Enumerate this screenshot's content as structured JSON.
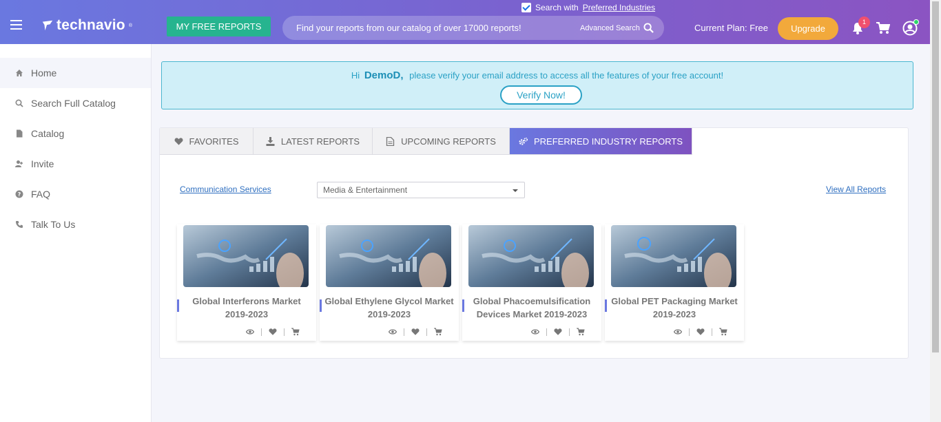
{
  "header": {
    "logo_text": "technavio",
    "logo_mark": "®",
    "free_reports_label": "MY FREE REPORTS",
    "search_placeholder": "Find your reports from our catalog of over 17000 reports!",
    "advanced_search": "Advanced Search",
    "pref_prefix": "Search with",
    "pref_link": "Preferred Industries",
    "pref_checked": true,
    "plan_text": "Current Plan: Free",
    "upgrade_label": "Upgrade",
    "notification_count": "1"
  },
  "sidebar": {
    "items": [
      {
        "label": "Home",
        "icon": "home-icon"
      },
      {
        "label": "Search Full Catalog",
        "icon": "search-icon"
      },
      {
        "label": "Catalog",
        "icon": "file-icon"
      },
      {
        "label": "Invite",
        "icon": "user-plus-icon"
      },
      {
        "label": "FAQ",
        "icon": "question-circle-icon"
      },
      {
        "label": "Talk To Us",
        "icon": "phone-icon"
      }
    ]
  },
  "alert": {
    "greeting": "Hi",
    "username": "DemoD,",
    "message": "please verify your email address to access all the features of your free account!",
    "verify_label": "Verify Now!"
  },
  "tabs": [
    {
      "label": "FAVORITES",
      "icon": "heart-icon"
    },
    {
      "label": "LATEST REPORTS",
      "icon": "download-icon"
    },
    {
      "label": "UPCOMING REPORTS",
      "icon": "document-icon"
    },
    {
      "label": "PREFERRED INDUSTRY REPORTS",
      "icon": "cogs-icon"
    }
  ],
  "filters": {
    "industry_link": "Communication Services",
    "subindustry_selected": "Media & Entertainment",
    "view_all": "View All Reports"
  },
  "reports": [
    {
      "title": "Global Interferons Market 2019-2023"
    },
    {
      "title": "Global Ethylene Glycol Market 2019-2023"
    },
    {
      "title": "Global Phacoemulsification Devices Market 2019-2023"
    },
    {
      "title": "Global PET Packaging Market 2019-2023"
    }
  ],
  "colors": {
    "header_start": "#6a78e0",
    "header_end": "#8b54c2",
    "free_reports_button": "#26b48f",
    "upgrade_button": "#f2a93b",
    "alert_bg": "#d0eff8",
    "link": "#2f6fc0"
  }
}
